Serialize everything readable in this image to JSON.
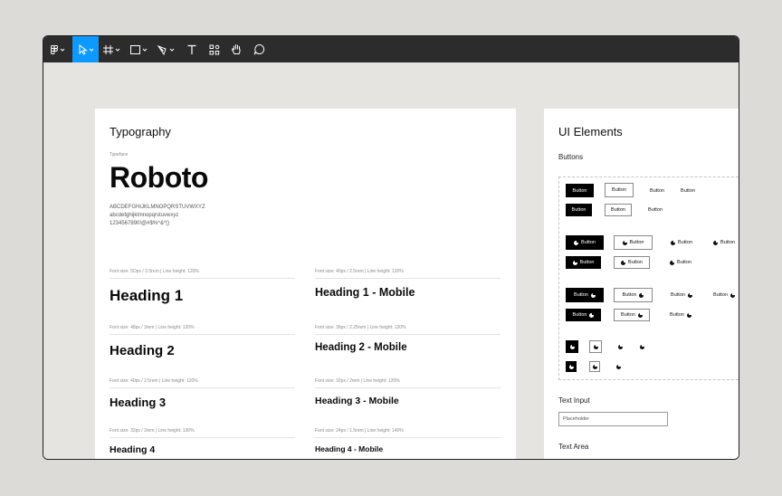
{
  "toolbar": {
    "tools": [
      "main-menu",
      "move",
      "frame",
      "shape",
      "pen",
      "text",
      "resources",
      "hand",
      "comment"
    ],
    "active_tool": "move"
  },
  "typography": {
    "title": "Typography",
    "typeface_label": "Typeface",
    "typeface": "Roboto",
    "charset": {
      "upper": "ABCDEFGHIJKLMNOPQRSTUVWXYZ",
      "lower": "abcdefghijklmnopqrstuvwxyz",
      "digits": "1234567890!@#$%^&*()"
    },
    "desktop": [
      {
        "meta": "Font size: 5Opx / 3.5rem | Line height: 120%",
        "label": "Heading 1"
      },
      {
        "meta": "Font size: 48px / 3rem | Line height: 120%",
        "label": "Heading 2"
      },
      {
        "meta": "Font size: 40px / 2.5rem | Line height: 120%",
        "label": "Heading 3"
      },
      {
        "meta": "Font size: 32px / 2rem | Line height: 130%",
        "label": "Heading 4"
      }
    ],
    "mobile": [
      {
        "meta": "Font size: 40px / 2.5rem | Line height: 120%",
        "label": "Heading 1 - Mobile"
      },
      {
        "meta": "Font size: 36px / 2.25rem | Line height: 120%",
        "label": "Heading 2 - Mobile"
      },
      {
        "meta": "Font size: 32px / 2rem | Line height: 120%",
        "label": "Heading 3 - Mobile"
      },
      {
        "meta": "Font size: 24px / 1.5rem | Line height: 140%",
        "label": "Heading 4 - Mobile"
      }
    ]
  },
  "ui": {
    "title": "UI Elements",
    "buttons_label": "Buttons",
    "button_text": "Button",
    "text_input_label": "Text Input",
    "input_placeholder": "Placeholder",
    "text_area_label": "Text Area"
  },
  "colors": {
    "toolbar": "#2c2c2c",
    "active_tool": "#0d99ff",
    "canvas": "#e5e4e0"
  }
}
